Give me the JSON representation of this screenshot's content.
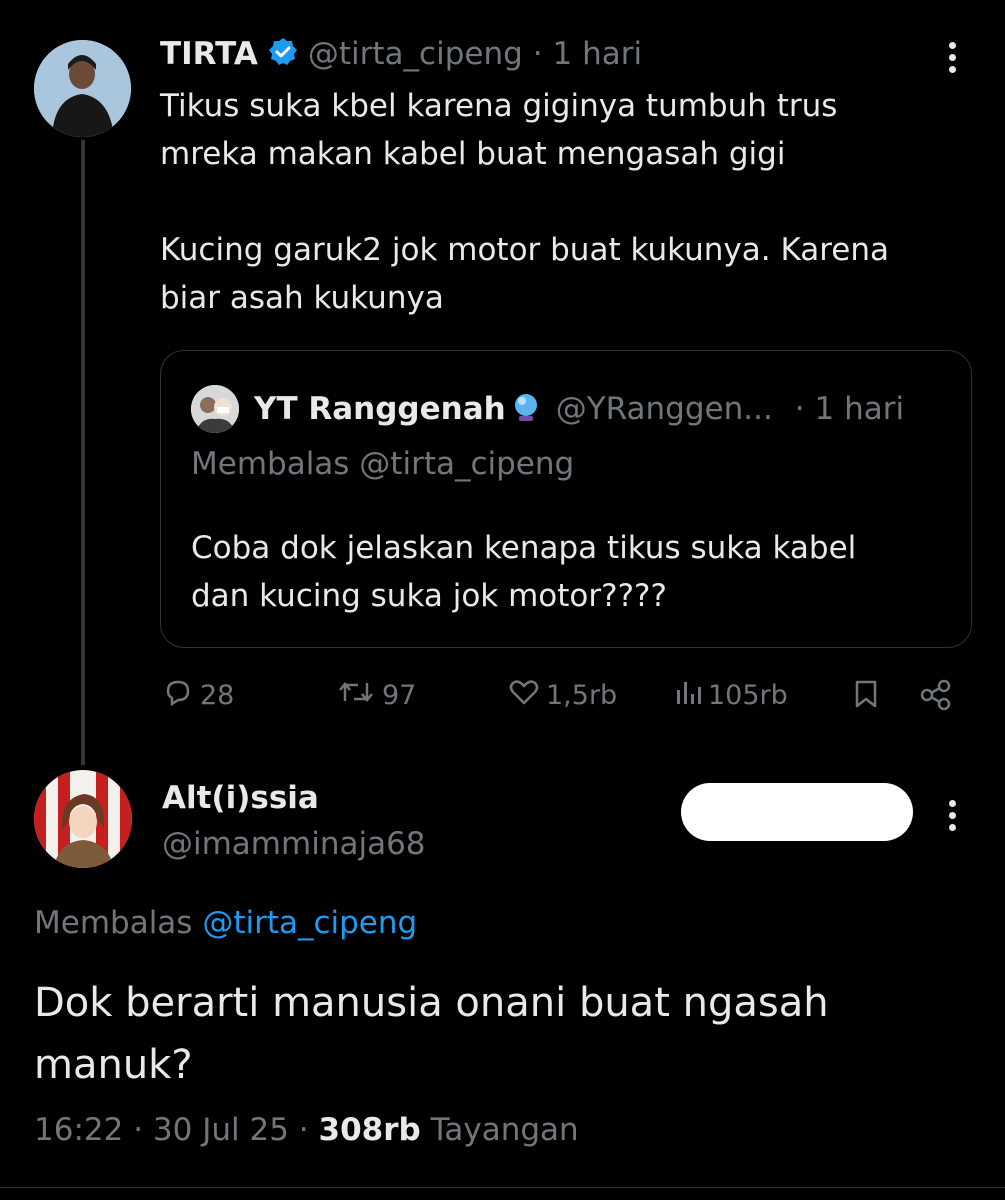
{
  "tweet": {
    "author_name": "TIRTA",
    "author_handle": "@tirta_cipeng",
    "time": "· 1 hari",
    "text": "Tikus suka kbel karena giginya tumbuh trus\nmreka makan kabel buat mengasah gigi\n\nKucing garuk2 jok motor buat kukunya. Karena\nbiar asah kukunya",
    "verified_color": "#1d9bf0"
  },
  "quote": {
    "author_name": "YT Ranggenah",
    "author_handle": "@YRanggen...",
    "time": "· 1 hari",
    "reply_to": "Membalas @tirta_cipeng",
    "text": "Coba dok jelaskan kenapa tikus suka kabel\ndan kucing suka jok motor????"
  },
  "actions": {
    "replies": "28",
    "reposts": "97",
    "likes": "1,5rb",
    "views": "105rb"
  },
  "reply": {
    "author_name": "Alt(i)ssia",
    "author_handle": "@imamminaja68",
    "reply_label": "Membalas",
    "reply_to": "@tirta_cipeng",
    "text": "Dok berarti manusia onani buat ngasah\nmanuk?",
    "time": "16:22",
    "date": "30 Jul 25",
    "views_count": "308rb",
    "views_label": "Tayangan"
  },
  "icons": {
    "reply": "speech-bubble-icon",
    "repost": "repost-arrows-icon",
    "like": "heart-icon",
    "views": "bar-chart-icon",
    "bookmark": "bookmark-icon",
    "share": "share-icon",
    "more": "vertical-dots-icon"
  }
}
